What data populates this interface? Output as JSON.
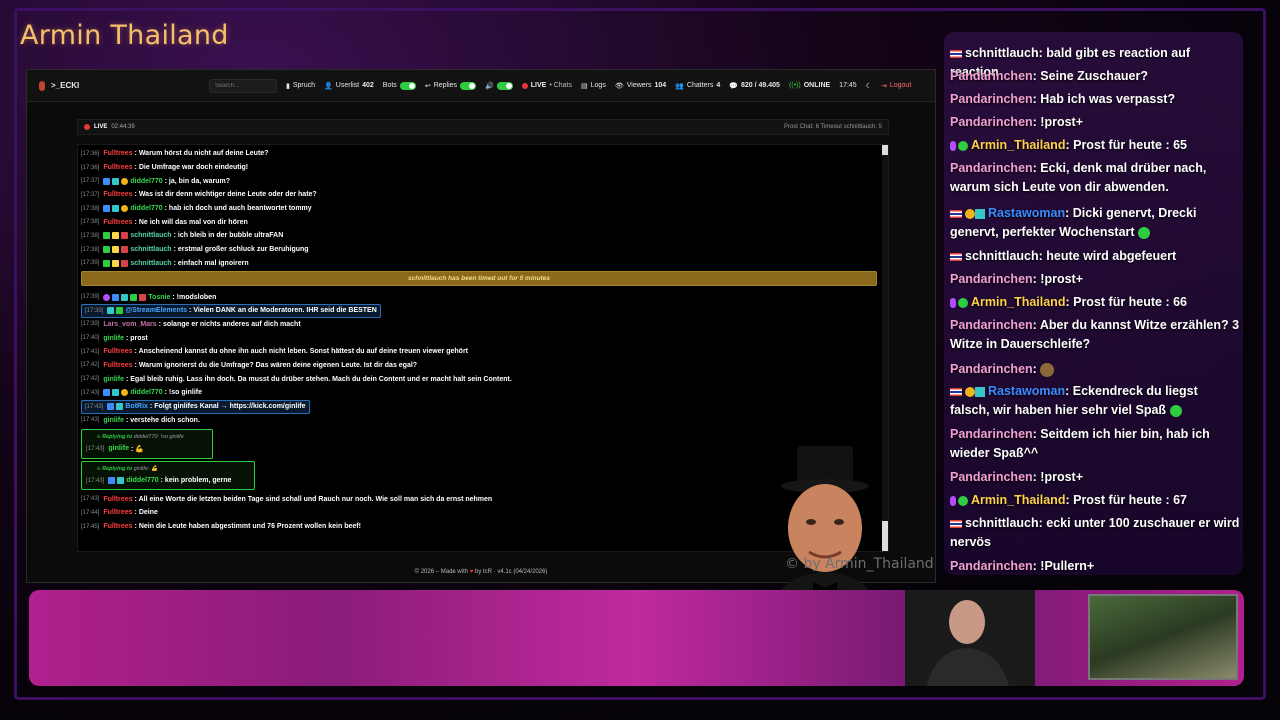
{
  "stream_title": "Armin Thailand",
  "topbar": {
    "channel": ">_ECKI",
    "search_placeholder": "Search...",
    "spruch": "Spruch",
    "userlist": "Userlist",
    "userlist_count": "402",
    "bots": "Bots",
    "replies": "Replies",
    "live_chats": "LIVE",
    "live_chats_suffix": "• Chats",
    "logs": "Logs",
    "viewers": "Viewers",
    "viewers_count": "104",
    "chatters": "Chatters",
    "chatters_count": "4",
    "messages": "820 / 49.405",
    "status": "ONLINE",
    "clock": "17:45",
    "logout": "Logout"
  },
  "livebar": {
    "live_label": "LIVE",
    "duration": "02:44:39",
    "right": "Prost Chat: 6  Timeout schnittlauch: 5"
  },
  "chat": [
    {
      "ts": "[17:36]",
      "user": "Fulltrees",
      "uc": "red",
      "badges": [],
      "text": ": Warum hörst du nicht auf deine Leute?"
    },
    {
      "ts": "[17:36]",
      "user": "Fulltrees",
      "uc": "red",
      "badges": [],
      "text": ": Die Umfrage war doch eindeutig!"
    },
    {
      "ts": "[17:37]",
      "user": "diddel770",
      "uc": "green",
      "badges": [
        "blue",
        "teal",
        "gold"
      ],
      "text": ": ja, bin da, warum?"
    },
    {
      "ts": "[17:37]",
      "user": "Fulltrees",
      "uc": "red",
      "badges": [],
      "text": ": Was ist dir denn wichtiger deine Leute oder der hate?"
    },
    {
      "ts": "[17:38]",
      "user": "diddel770",
      "uc": "green",
      "badges": [
        "blue",
        "teal",
        "gold"
      ],
      "text": ": hab ich doch und auch beantwortet tommy"
    },
    {
      "ts": "[17:38]",
      "user": "Fulltrees",
      "uc": "red",
      "badges": [],
      "text": ": Ne ich will das mal von dir hören"
    },
    {
      "ts": "[17:38]",
      "user": "schnittlauch",
      "uc": "teal",
      "badges": [
        "green",
        "yellow",
        "red"
      ],
      "text": ": ich bleib in der bubble ultraFAN"
    },
    {
      "ts": "[17:38]",
      "user": "schnittlauch",
      "uc": "teal",
      "badges": [
        "green",
        "yellow",
        "red"
      ],
      "text": ": erstmal großer schluck zur Beruhigung"
    },
    {
      "ts": "[17:39]",
      "user": "schnittlauch",
      "uc": "teal",
      "badges": [
        "green",
        "yellow",
        "red"
      ],
      "text": ": einfach mal ignoirern"
    }
  ],
  "timeout_notice": "schnittlauch has been timed out for 5 minutes",
  "chat2": [
    {
      "ts": "[17:39]",
      "user": "Tosnie",
      "uc": "green",
      "badges": [
        "purple",
        "blue",
        "teal",
        "green",
        "red"
      ],
      "text": ": !modsloben",
      "hl": false
    },
    {
      "ts": "[17:39]",
      "user": "@StreamElements",
      "uc": "blue",
      "badges": [
        "teal",
        "green"
      ],
      "text": ": Vielen DANK an die Moderatoren. IHR seid die BESTEN",
      "hl": true
    },
    {
      "ts": "[17:39]",
      "user": "Lars_vom_Mars",
      "uc": "pink",
      "badges": [],
      "text": ": solange er nichts anderes auf dich macht",
      "hl": false
    },
    {
      "ts": "[17:40]",
      "user": "ginlife",
      "uc": "green",
      "badges": [],
      "text": ": prost",
      "hl": false
    },
    {
      "ts": "[17:41]",
      "user": "Fulltrees",
      "uc": "red",
      "badges": [],
      "text": ": Anscheinend kannst du ohne ihn auch nicht leben. Sonst hättest du auf deine treuen viewer gehört",
      "hl": false
    },
    {
      "ts": "[17:42]",
      "user": "Fulltrees",
      "uc": "red",
      "badges": [],
      "text": ": Warum ignorierst du die Umfrage? Das wären deine eigenen Leute. Ist dir das egal?",
      "hl": false
    },
    {
      "ts": "[17:42]",
      "user": "ginlife",
      "uc": "green",
      "badges": [],
      "text": ": Egal bleib ruhig. Lass ihn doch. Da musst du drüber stehen. Mach du dein Content und er macht halt sein Content.",
      "hl": false
    },
    {
      "ts": "[17:43]",
      "user": "diddel770",
      "uc": "green",
      "badges": [
        "blue",
        "teal",
        "gold"
      ],
      "text": ": !so ginlife",
      "hl": false
    },
    {
      "ts": "[17:43]",
      "user": "BotRix",
      "uc": "blue",
      "badges": [
        "blue",
        "teal"
      ],
      "text": ": Folgt ginlifes Kanal → https://kick.com/ginlife",
      "hl": true
    },
    {
      "ts": "[17:43]",
      "user": "ginlife",
      "uc": "green",
      "badges": [],
      "text": ": verstehe dich schon.",
      "hl": false
    }
  ],
  "reply1": {
    "replying": "Replying to",
    "target": "diddel770: !so ginlife",
    "ts": "[17:43]",
    "user": "ginlife",
    "text": ": 💪"
  },
  "reply2": {
    "replying": "Replying to",
    "target": "ginlife: 💪",
    "ts": "[17:43]",
    "user": "diddel770",
    "text": ": kein problem, gerne"
  },
  "chat3": [
    {
      "ts": "[17:43]",
      "user": "Fulltrees",
      "uc": "red",
      "text": ": All eine Worte die letzten beiden Tage sind schall und Rauch nur noch. Wie soll man sich da ernst nehmen"
    },
    {
      "ts": "[17:44]",
      "user": "Fulltrees",
      "uc": "red",
      "text": ": Deine"
    },
    {
      "ts": "[17:45]",
      "user": "Fulltrees",
      "uc": "red",
      "text": ": Nein die Leute haben abgestimmt und 76 Prozent wollen kein beef!"
    }
  ],
  "footer": {
    "pre": "© 2026 – Made with",
    "heart": "♥",
    "post": "by tcR · v4.1c (04/24/2026)"
  },
  "watermark": "© by Armin_Thailand",
  "side_chat": [
    {
      "user": "schnittlauch",
      "nc": "white",
      "icons": [
        "flag"
      ],
      "text": ": bald gibt es reaction auf reaction"
    },
    {
      "user": "Pandarinchen",
      "nc": "pink",
      "icons": [],
      "text": ": Seine Zuschauer?"
    },
    {
      "user": "Pandarinchen",
      "nc": "pink",
      "icons": [],
      "text": ": Hab ich was verpasst?"
    },
    {
      "user": "Pandarinchen",
      "nc": "pink",
      "icons": [],
      "text": ": !prost+"
    },
    {
      "user": "Armin_Thailand",
      "nc": "gold",
      "icons": [
        "mic",
        "check"
      ],
      "text": ": Prost für heute : 65"
    },
    {
      "user": "Pandarinchen",
      "nc": "pink",
      "icons": [],
      "text": ": Ecki, denk mal drüber nach, warum sich Leute von dir abwenden."
    },
    {
      "user": "Rastawoman",
      "nc": "blue",
      "icons": [
        "flag",
        "gold",
        "sq"
      ],
      "text": ": Dicki genervt, Drecki genervt, perfekter Wochenstart"
    },
    {
      "user": "schnittlauch",
      "nc": "white",
      "icons": [
        "flag"
      ],
      "text": ": heute wird abgefeuert"
    },
    {
      "user": "Pandarinchen",
      "nc": "pink",
      "icons": [],
      "text": ": !prost+"
    },
    {
      "user": "Armin_Thailand",
      "nc": "gold",
      "icons": [
        "mic",
        "check"
      ],
      "text": ": Prost für heute : 66"
    },
    {
      "user": "Pandarinchen",
      "nc": "pink",
      "icons": [],
      "text": ": Aber du kannst Witze erzählen? 3 Witze in Dauerschleife?"
    },
    {
      "user": "Pandarinchen",
      "nc": "pink",
      "icons": [],
      "text": ":"
    },
    {
      "user": "Rastawoman",
      "nc": "blue",
      "icons": [
        "flag",
        "gold",
        "sq"
      ],
      "text": ": Eckendreck du liegst falsch, wir haben hier sehr viel Spaß"
    },
    {
      "user": "Pandarinchen",
      "nc": "pink",
      "icons": [],
      "text": ": Seitdem ich hier bin, hab ich wieder Spaß^^"
    },
    {
      "user": "Pandarinchen",
      "nc": "pink",
      "icons": [],
      "text": ": !prost+"
    },
    {
      "user": "Armin_Thailand",
      "nc": "gold",
      "icons": [
        "mic",
        "check"
      ],
      "text": ": Prost für heute : 67"
    },
    {
      "user": "schnittlauch",
      "nc": "white",
      "icons": [
        "flag"
      ],
      "text": ": ecki unter 100 zuschauer er wird nervös"
    },
    {
      "user": "Pandarinchen",
      "nc": "pink",
      "icons": [],
      "text": ": !Pullern+"
    }
  ]
}
